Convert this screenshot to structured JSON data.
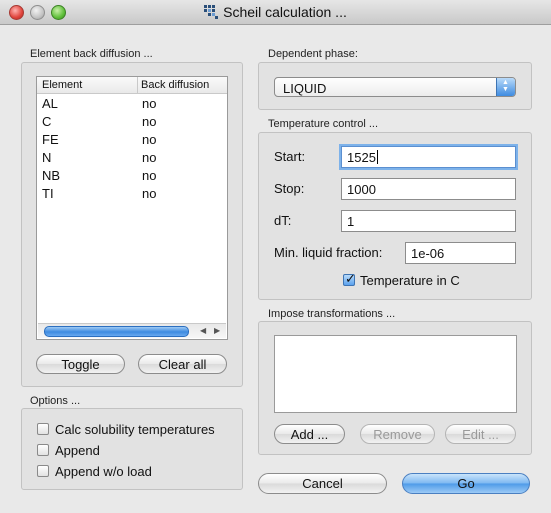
{
  "window": {
    "title": "Scheil calculation ..."
  },
  "back_diffusion": {
    "group_label": "Element back diffusion ...",
    "columns": [
      "Element",
      "Back diffusion"
    ],
    "rows": [
      {
        "element": "AL",
        "value": "no"
      },
      {
        "element": "C",
        "value": "no"
      },
      {
        "element": "FE",
        "value": "no"
      },
      {
        "element": "N",
        "value": "no"
      },
      {
        "element": "NB",
        "value": "no"
      },
      {
        "element": "TI",
        "value": "no"
      }
    ],
    "toggle_label": "Toggle",
    "clear_all_label": "Clear all"
  },
  "options": {
    "group_label": "Options ...",
    "items": [
      {
        "label": "Calc solubility temperatures",
        "checked": false
      },
      {
        "label": "Append",
        "checked": false
      },
      {
        "label": "Append w/o load",
        "checked": false
      }
    ]
  },
  "dependent_phase": {
    "group_label": "Dependent phase:",
    "selected": "LIQUID"
  },
  "temperature_control": {
    "group_label": "Temperature control ...",
    "start_label": "Start:",
    "start_value": "1525",
    "stop_label": "Stop:",
    "stop_value": "1000",
    "dt_label": "dT:",
    "dt_value": "1",
    "min_liquid_label": "Min. liquid fraction:",
    "min_liquid_value": "1e-06",
    "temp_in_c_label": "Temperature in C",
    "temp_in_c_checked": true
  },
  "impose_transformations": {
    "group_label": "Impose transformations ...",
    "add_label": "Add ...",
    "remove_label": "Remove",
    "edit_label": "Edit ..."
  },
  "actions": {
    "cancel_label": "Cancel",
    "go_label": "Go"
  },
  "colors": {
    "accent_blue": "#4d9ae8",
    "focus_ring": "#7db2ea"
  }
}
